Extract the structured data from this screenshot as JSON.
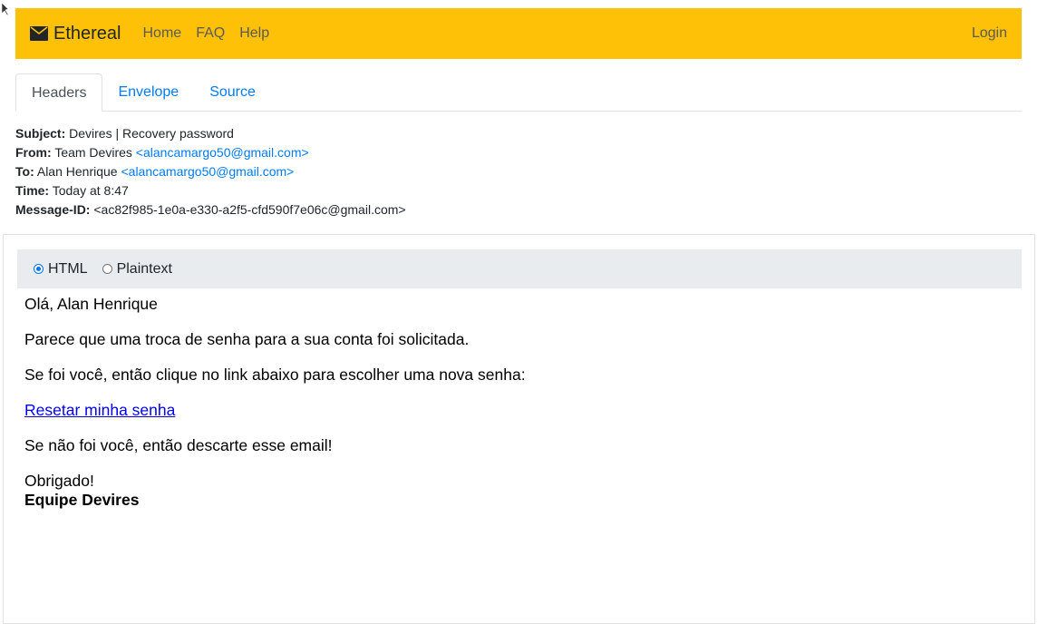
{
  "nav": {
    "brand": "Ethereal",
    "links": [
      "Home",
      "FAQ",
      "Help"
    ],
    "login": "Login",
    "colors": {
      "bar": "#ffc107"
    }
  },
  "tabs": [
    {
      "label": "Headers",
      "active": true
    },
    {
      "label": "Envelope",
      "active": false
    },
    {
      "label": "Source",
      "active": false
    }
  ],
  "headers": {
    "subject": {
      "label": "Subject:",
      "value": "Devires | Recovery password"
    },
    "from": {
      "label": "From:",
      "name": "Team Devires",
      "email": "<alancamargo50@gmail.com>"
    },
    "to": {
      "label": "To:",
      "name": "Alan Henrique",
      "email": "<alancamargo50@gmail.com>"
    },
    "time": {
      "label": "Time:",
      "value": "Today at 8:47"
    },
    "message_id": {
      "label": "Message-ID:",
      "value": "<ac82f985-1e0a-e330-a2f5-cfd590f7e06c@gmail.com>"
    }
  },
  "format": {
    "options": [
      "HTML",
      "Plaintext"
    ],
    "selected": "HTML"
  },
  "email_body": {
    "greeting": "Olá, Alan Henrique",
    "line1": "Parece que uma troca de senha para a sua conta foi solicitada.",
    "line2": "Se foi você, então clique no link abaixo para escolher uma nova senha:",
    "link": "Resetar minha senha",
    "line3": "Se não foi você, então descarte esse email!",
    "thanks": "Obrigado!",
    "signature": "Equipe Devires"
  }
}
